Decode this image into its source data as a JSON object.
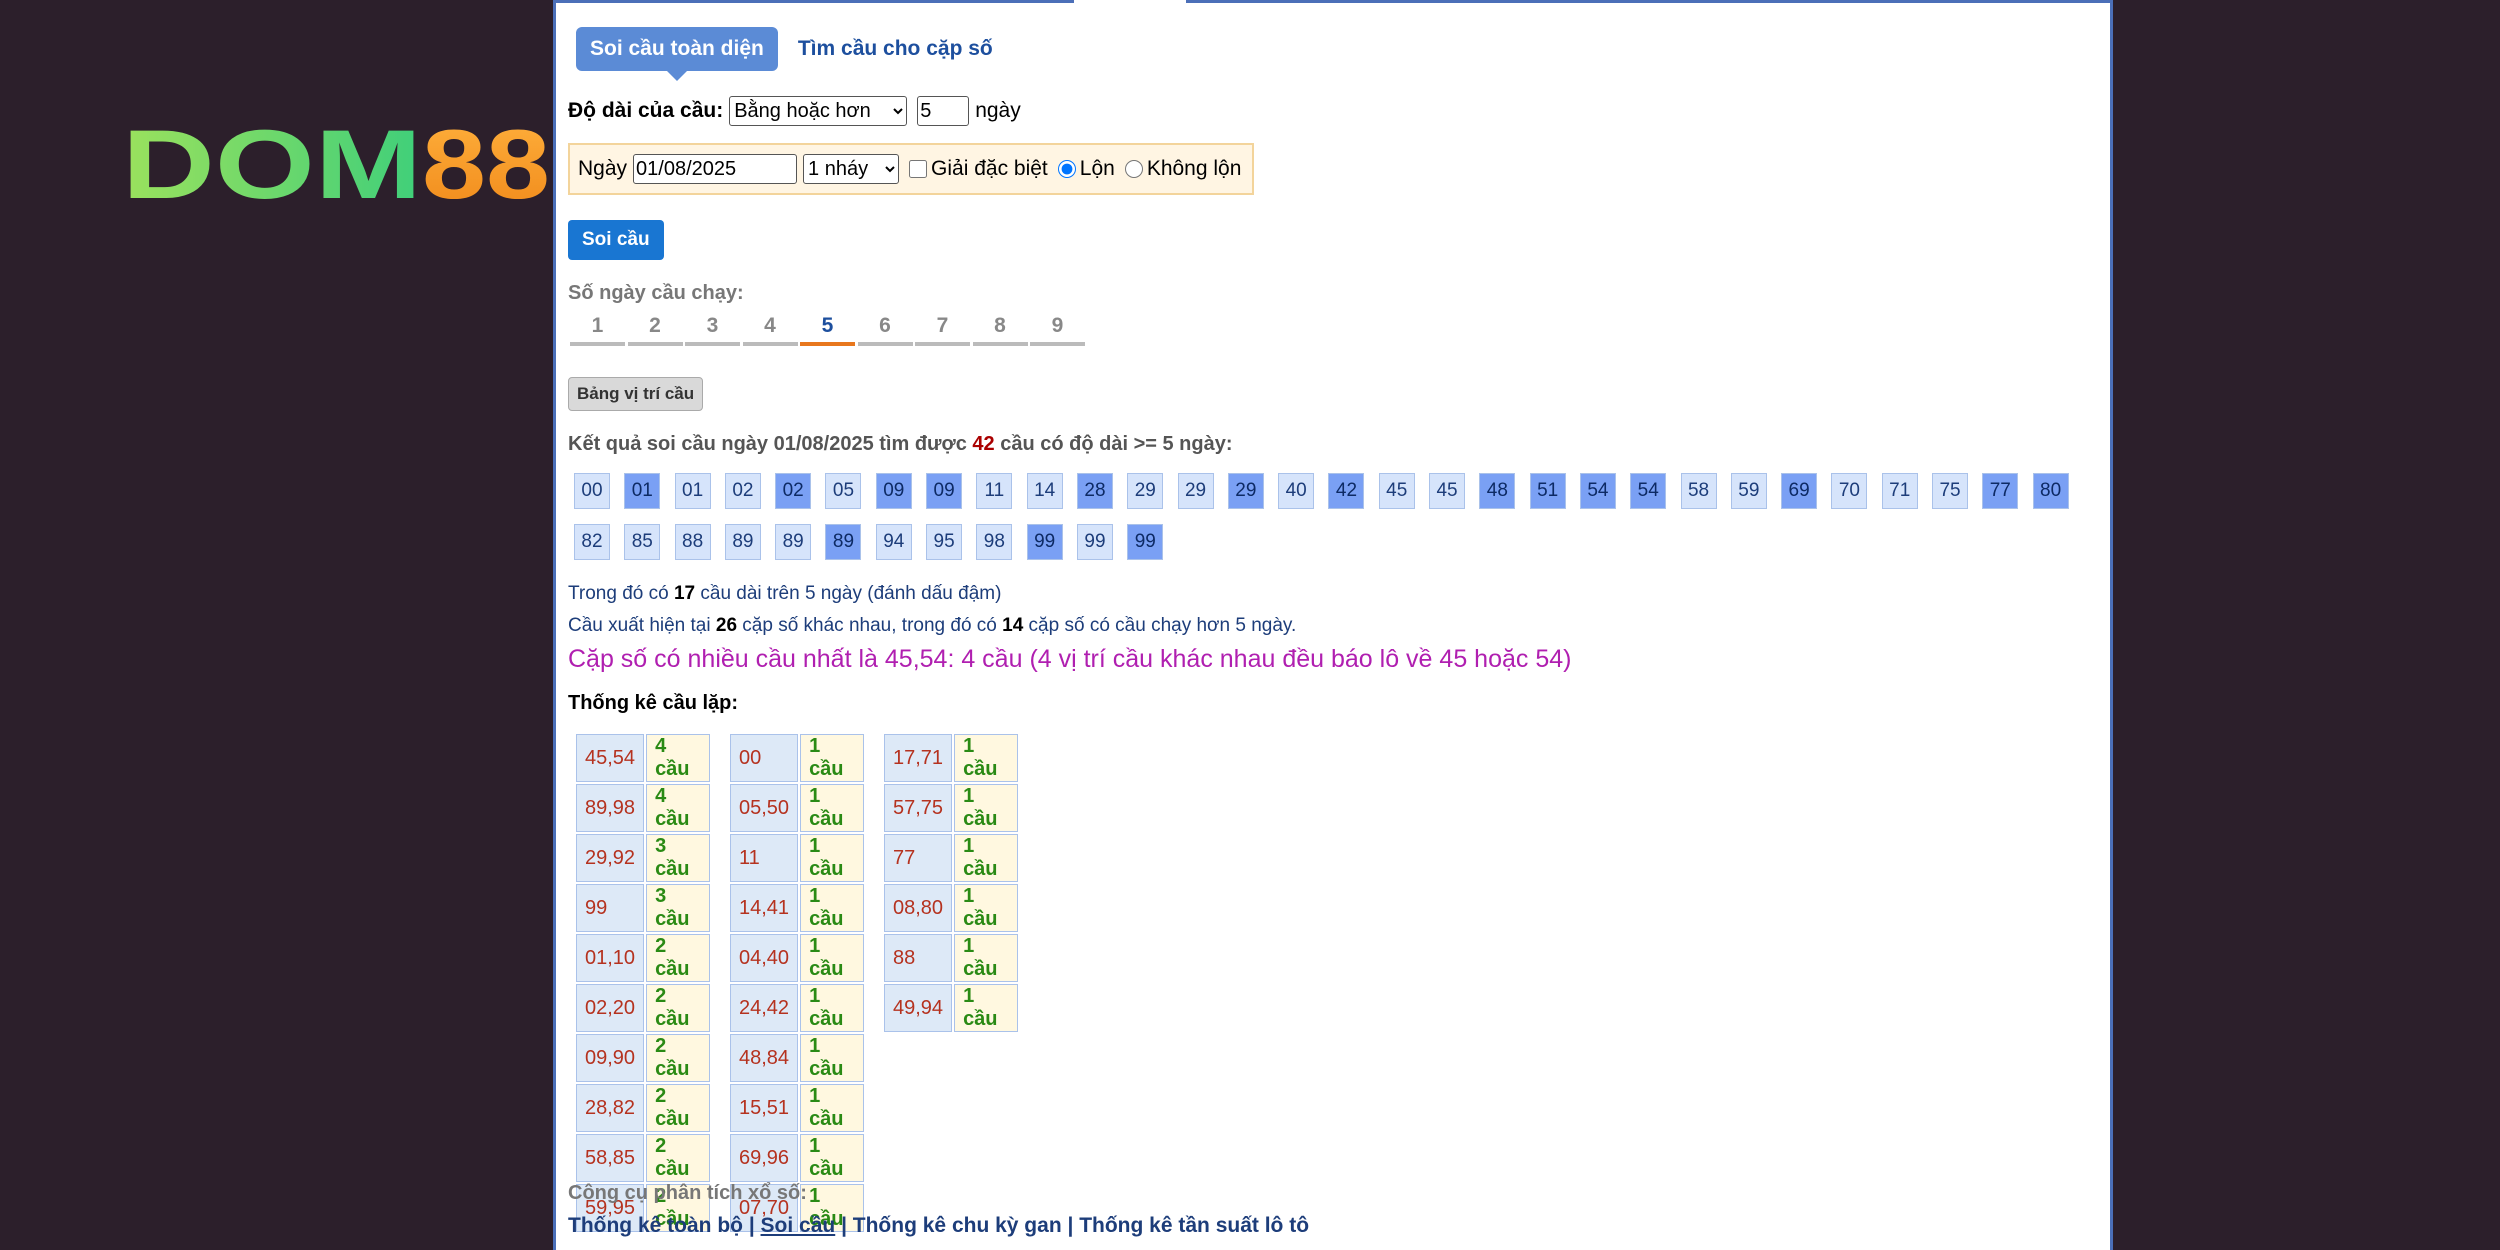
{
  "logo": {
    "text_a": "DOM",
    "text_b": "88"
  },
  "tabs": [
    "Soi cầu toàn diện",
    "Tìm cầu cho cặp số"
  ],
  "form": {
    "length_label": "Độ dài của cầu:",
    "length_option": "Bằng hoặc hơn",
    "length_value": "5",
    "length_unit": "ngày",
    "date_label": "Ngày",
    "date_value": "01/08/2025",
    "jump_option": "1 nháy",
    "special_label": "Giải đặc biệt",
    "reverse_label": "Lộn",
    "no_reverse_label": "Không lộn",
    "submit_label": "Soi cầu"
  },
  "days": {
    "title": "Số ngày cầu chạy:",
    "items": [
      "1",
      "2",
      "3",
      "4",
      "5",
      "6",
      "7",
      "8",
      "9"
    ],
    "selected": "5"
  },
  "position_table_label": "Bảng vị trí cầu",
  "result": {
    "prefix": "Kết quả soi cầu ngày 01/08/2025 tìm được ",
    "count": "42",
    "suffix": " cầu có độ dài >= 5 ngày:"
  },
  "pairs_row1": [
    {
      "n": "00",
      "hl": false
    },
    {
      "n": "01",
      "hl": true
    },
    {
      "n": "01",
      "hl": false
    },
    {
      "n": "02",
      "hl": false
    },
    {
      "n": "02",
      "hl": true
    },
    {
      "n": "05",
      "hl": false
    },
    {
      "n": "09",
      "hl": true
    },
    {
      "n": "09",
      "hl": true
    },
    {
      "n": "11",
      "hl": false
    },
    {
      "n": "14",
      "hl": false
    },
    {
      "n": "28",
      "hl": true
    },
    {
      "n": "29",
      "hl": false
    },
    {
      "n": "29",
      "hl": false
    },
    {
      "n": "29",
      "hl": true
    },
    {
      "n": "40",
      "hl": false
    },
    {
      "n": "42",
      "hl": true
    },
    {
      "n": "45",
      "hl": false
    },
    {
      "n": "45",
      "hl": false
    },
    {
      "n": "48",
      "hl": true
    },
    {
      "n": "51",
      "hl": true
    },
    {
      "n": "54",
      "hl": true
    },
    {
      "n": "54",
      "hl": true
    },
    {
      "n": "58",
      "hl": false
    },
    {
      "n": "59",
      "hl": false
    },
    {
      "n": "69",
      "hl": true
    },
    {
      "n": "70",
      "hl": false
    },
    {
      "n": "71",
      "hl": false
    },
    {
      "n": "75",
      "hl": false
    },
    {
      "n": "77",
      "hl": true
    },
    {
      "n": "80",
      "hl": true
    }
  ],
  "pairs_row2": [
    {
      "n": "82",
      "hl": false
    },
    {
      "n": "85",
      "hl": false
    },
    {
      "n": "88",
      "hl": false
    },
    {
      "n": "89",
      "hl": false
    },
    {
      "n": "89",
      "hl": false
    },
    {
      "n": "89",
      "hl": true
    },
    {
      "n": "94",
      "hl": false
    },
    {
      "n": "95",
      "hl": false
    },
    {
      "n": "98",
      "hl": false
    },
    {
      "n": "99",
      "hl": true
    },
    {
      "n": "99",
      "hl": false
    },
    {
      "n": "99",
      "hl": true
    }
  ],
  "notes": {
    "line1_a": "Trong đó có ",
    "line1_b": "17",
    "line1_c": " cầu dài trên 5 ngày (đánh dấu đậm)",
    "line2_a": "Cầu xuất hiện tại ",
    "line2_b": "26",
    "line2_c": " cặp số khác nhau, trong đó có ",
    "line2_d": "14",
    "line2_e": " cặp số có cầu chạy hơn 5 ngày.",
    "highlight": "Cặp số có nhiều cầu nhất là 45,54: 4 cầu (4 vị trí cầu khác nhau đều báo lô về 45 hoặc 54)"
  },
  "stats_title": "Thống kê cầu lặp:",
  "stats": [
    [
      [
        "45,54",
        "4 cầu"
      ],
      [
        "89,98",
        "4 cầu"
      ],
      [
        "29,92",
        "3 cầu"
      ],
      [
        "99",
        "3 cầu"
      ],
      [
        "01,10",
        "2 cầu"
      ],
      [
        "02,20",
        "2 cầu"
      ],
      [
        "09,90",
        "2 cầu"
      ],
      [
        "28,82",
        "2 cầu"
      ],
      [
        "58,85",
        "2 cầu"
      ],
      [
        "59,95",
        "2 cầu"
      ]
    ],
    [
      [
        "00",
        "1 cầu"
      ],
      [
        "05,50",
        "1 cầu"
      ],
      [
        "11",
        "1 cầu"
      ],
      [
        "14,41",
        "1 cầu"
      ],
      [
        "04,40",
        "1 cầu"
      ],
      [
        "24,42",
        "1 cầu"
      ],
      [
        "48,84",
        "1 cầu"
      ],
      [
        "15,51",
        "1 cầu"
      ],
      [
        "69,96",
        "1 cầu"
      ],
      [
        "07,70",
        "1 cầu"
      ]
    ],
    [
      [
        "17,71",
        "1 cầu"
      ],
      [
        "57,75",
        "1 cầu"
      ],
      [
        "77",
        "1 cầu"
      ],
      [
        "08,80",
        "1 cầu"
      ],
      [
        "88",
        "1 cầu"
      ],
      [
        "49,94",
        "1 cầu"
      ]
    ]
  ],
  "footer": {
    "title": "Công cụ phân tích xổ số:",
    "links": [
      "Thống kê toàn bộ",
      "Soi cầu",
      "Thống kê chu kỳ gan",
      "Thống kê tần suất lô tô"
    ],
    "separator": " | "
  }
}
